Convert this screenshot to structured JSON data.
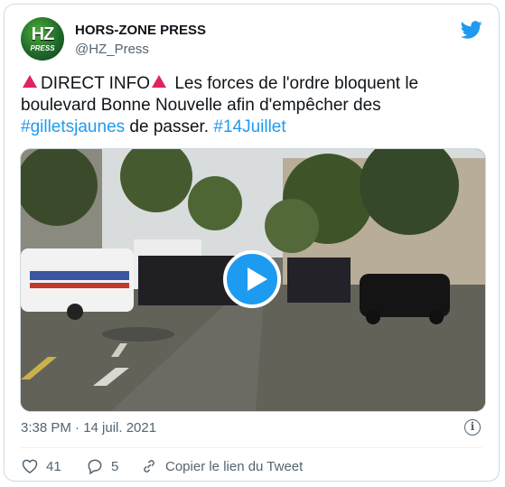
{
  "account": {
    "name": "HORS-ZONE PRESS",
    "handle": "@HZ_Press",
    "avatar_top": "HZ",
    "avatar_bottom": "PRESS"
  },
  "tweet": {
    "lead": "DIRECT INFO",
    "body_1": " Les forces de l'ordre bloquent le boulevard Bonne Nouvelle afin d'empêcher des ",
    "hashtag_1": "#gilletsjaunes",
    "body_2": " de passer. ",
    "hashtag_2": "#14Juillet"
  },
  "meta": {
    "timestamp": "3:38 PM · 14 juil. 2021",
    "info_glyph": "i"
  },
  "actions": {
    "likes": "41",
    "replies": "5",
    "copy_label": "Copier le lien du Tweet"
  },
  "colors": {
    "accent": "#1d9bf0",
    "alert": "#e0245e",
    "secondary_text": "#536471"
  },
  "icons": [
    "twitter-bird-icon",
    "play-icon",
    "info-icon",
    "heart-icon",
    "reply-icon",
    "link-icon",
    "warning-triangle-icon"
  ]
}
